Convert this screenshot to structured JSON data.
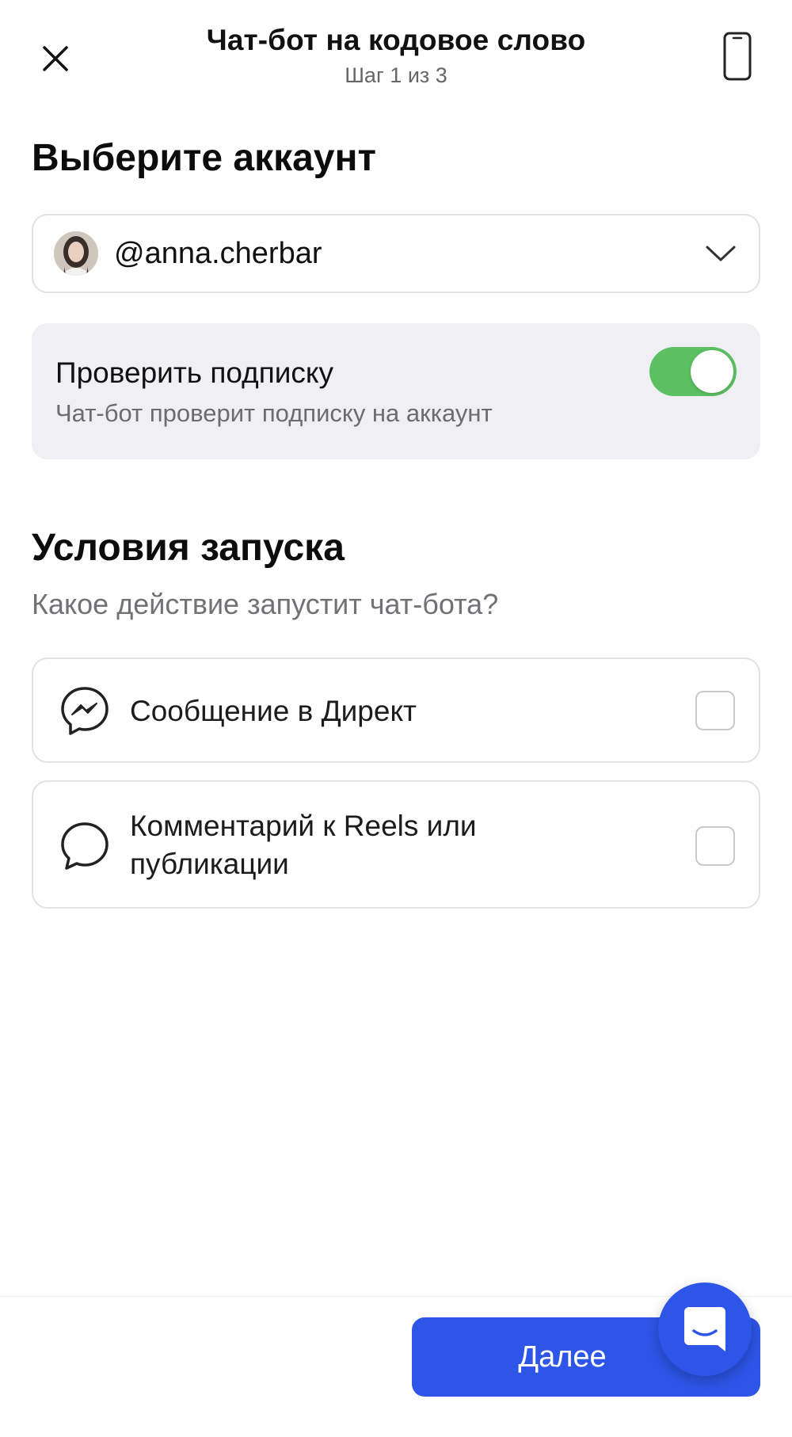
{
  "header": {
    "title": "Чат-бот на кодовое слово",
    "step": "Шаг 1 из 3"
  },
  "account_section": {
    "title": "Выберите аккаунт",
    "selected_account": "@anna.cherbar"
  },
  "subscription_check": {
    "title": "Проверить подписку",
    "description": "Чат-бот проверит подписку на аккаунт",
    "enabled": true
  },
  "launch_section": {
    "title": "Условия запуска",
    "hint": "Какое действие запустит чат-бота?",
    "options": [
      {
        "label": "Сообщение в Директ",
        "icon": "messenger-icon",
        "checked": false
      },
      {
        "label": "Комментарий к Reels или публикации",
        "icon": "comment-bubble-icon",
        "checked": false
      }
    ]
  },
  "footer": {
    "next_label": "Далее"
  },
  "colors": {
    "accent": "#2d56e9",
    "toggle_on": "#5cc062",
    "panel_bg": "#efeff4"
  }
}
